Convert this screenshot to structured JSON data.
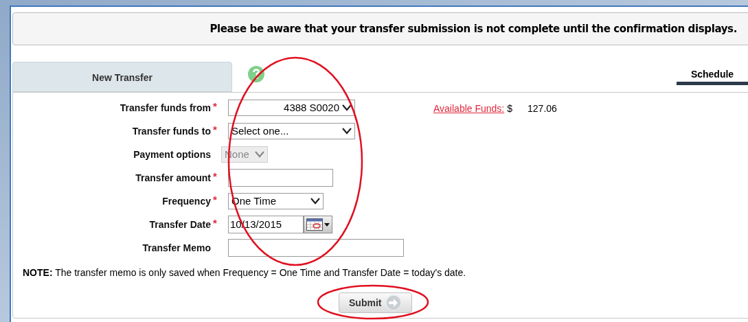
{
  "banner": "Please be aware that your transfer submission is not complete until the confirmation displays.",
  "tabs": [
    {
      "label": "New Transfer",
      "selected": false
    },
    {
      "label": "Schedule",
      "selected": true
    }
  ],
  "fields": [
    {
      "kind": "select",
      "label": "Transfer funds from",
      "required_mark": "*",
      "value": "4388 S0020",
      "disabled": false
    },
    {
      "kind": "select",
      "label": "Transfer funds to",
      "required_mark": "*",
      "value": "Select one...",
      "disabled": false
    },
    {
      "kind": "select",
      "label": "Payment options",
      "value": "None",
      "disabled": true
    },
    {
      "kind": "input",
      "label": "Transfer amount",
      "required_mark": "*"
    },
    {
      "kind": "select",
      "label": "Frequency",
      "required_mark": "*",
      "value": "One Time",
      "disabled": false
    },
    {
      "kind": "date",
      "label": "Transfer Date",
      "required_mark": "*",
      "value": "10/13/2015"
    },
    {
      "kind": "input",
      "label": "Transfer Memo"
    }
  ],
  "available_funds": {
    "label": "Available Funds:",
    "currency": "$",
    "amount": "127.06"
  },
  "note": "**NOTE:** The transfer memo is only saved when Frequency = One Time and Transfer Date = today's date.",
  "submit": "Submit",
  "annotations": [
    {
      "kind": "ellipse"
    },
    {
      "kind": "ellipse"
    }
  ]
}
